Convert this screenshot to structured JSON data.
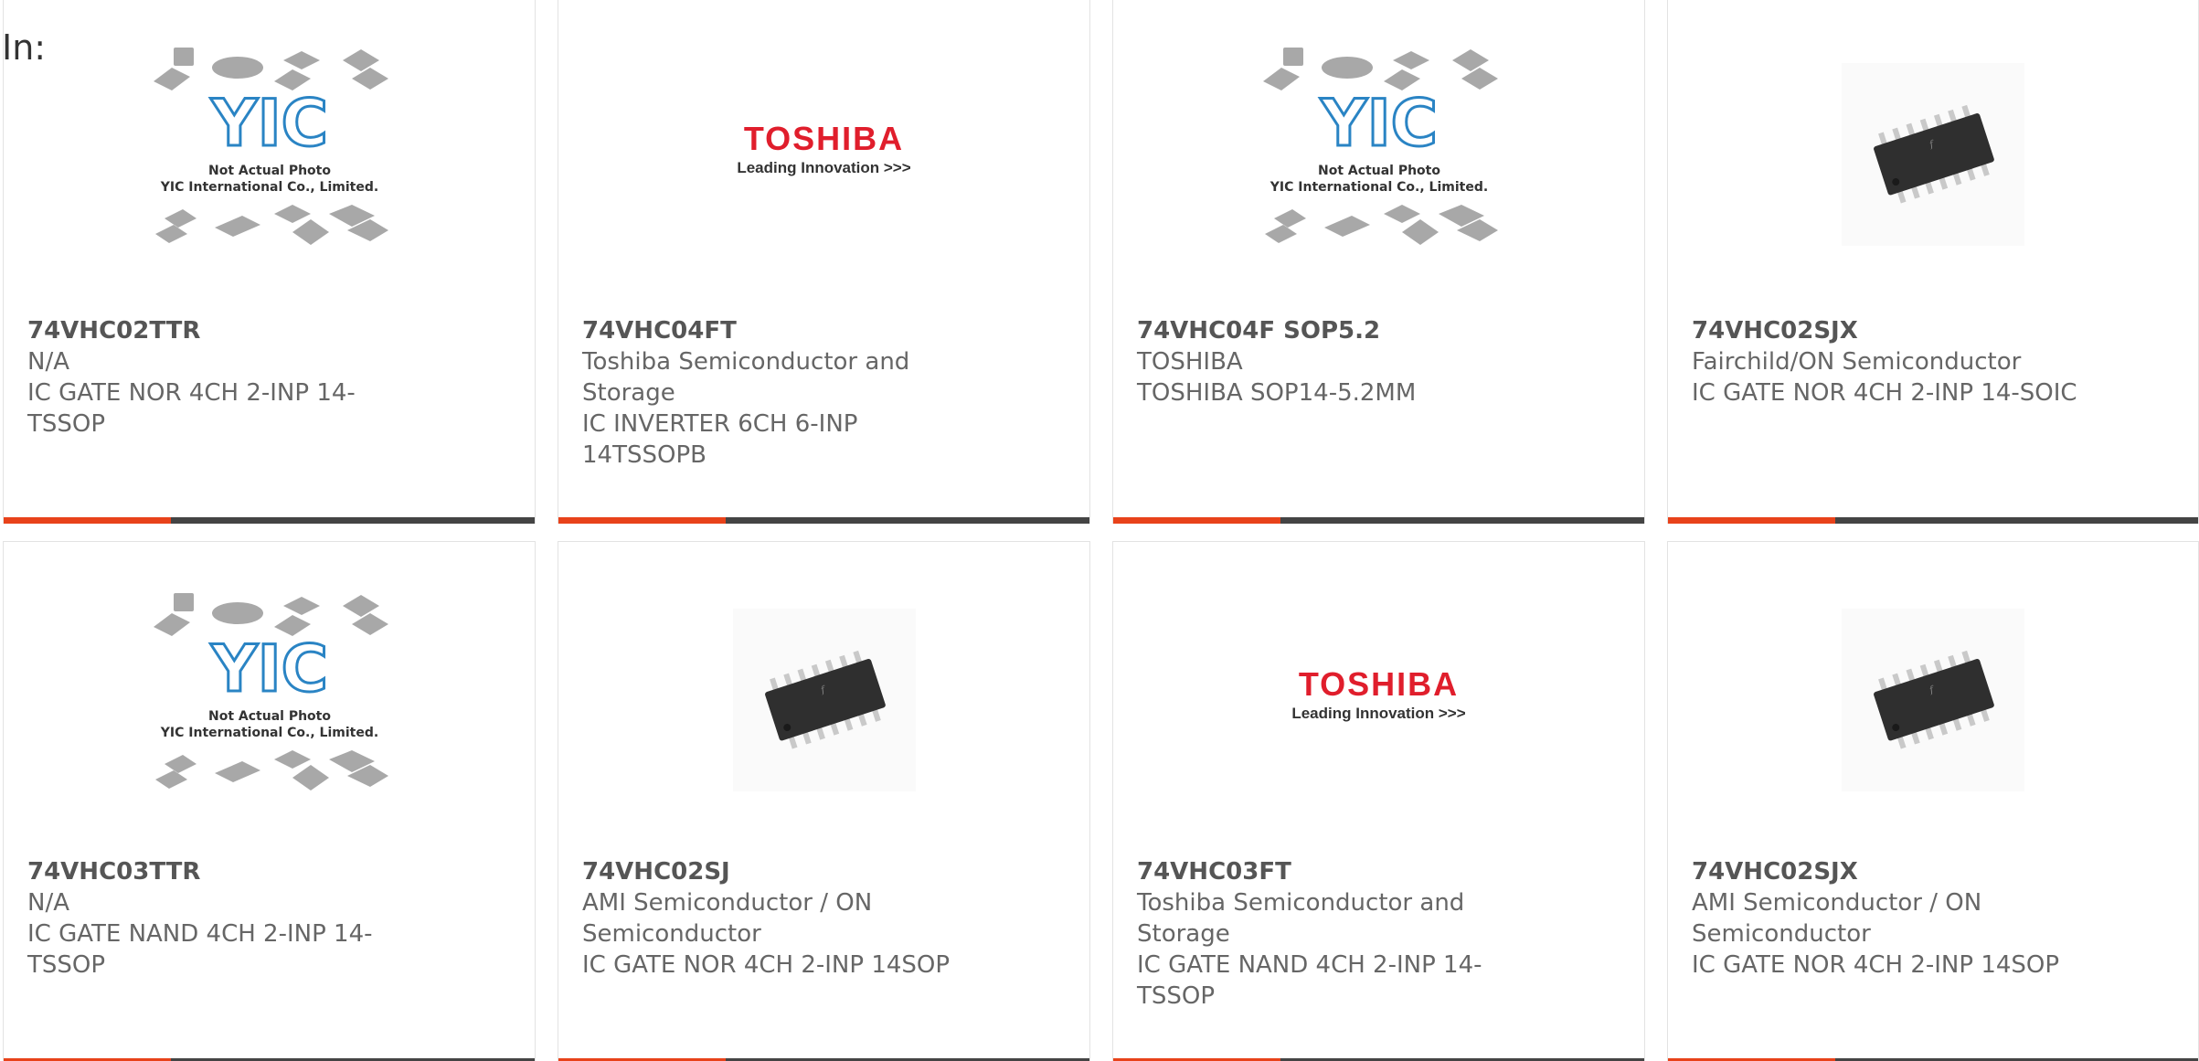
{
  "header": {
    "label": "In:"
  },
  "placeholder_image": {
    "line1": "Not Actual Photo",
    "line2": "YIC International Co., Limited.",
    "logo_text": "YIC"
  },
  "toshiba_logo": {
    "brand": "TOSHIBA",
    "tag": "Leading Innovation >>>"
  },
  "colors": {
    "accent": "#e8421a",
    "bar": "#444444",
    "toshiba_red": "#e01e2c",
    "yic_blue": "#2a84c4"
  },
  "products": [
    {
      "part": "74VHC02TTR",
      "maker": "N/A",
      "desc1": "IC GATE NOR 4CH 2-INP 14-",
      "desc2": "TSSOP",
      "image": "placeholder"
    },
    {
      "part": "74VHC04FT",
      "maker": "Toshiba Semiconductor and",
      "maker2": "Storage",
      "desc1": "IC INVERTER 6CH 6-INP",
      "desc2": "14TSSOPB",
      "image": "toshiba"
    },
    {
      "part": "74VHC04F SOP5.2",
      "maker": "TOSHIBA",
      "desc1": "TOSHIBA SOP14-5.2MM",
      "image": "placeholder"
    },
    {
      "part": "74VHC02SJX",
      "maker": "Fairchild/ON Semiconductor",
      "desc1": "IC GATE NOR 4CH 2-INP 14-SOIC",
      "image": "chip"
    },
    {
      "part": "74VHC03TTR",
      "maker": "N/A",
      "desc1": "IC GATE NAND 4CH 2-INP 14-",
      "desc2": "TSSOP",
      "image": "placeholder"
    },
    {
      "part": "74VHC02SJ",
      "maker": "AMI Semiconductor / ON",
      "maker2": "Semiconductor",
      "desc1": "IC GATE NOR 4CH 2-INP 14SOP",
      "image": "chip"
    },
    {
      "part": "74VHC03FT",
      "maker": "Toshiba Semiconductor and",
      "maker2": "Storage",
      "desc1": "IC GATE NAND 4CH 2-INP 14-",
      "desc2": "TSSOP",
      "image": "toshiba"
    },
    {
      "part": "74VHC02SJX",
      "maker": "AMI Semiconductor / ON",
      "maker2": "Semiconductor",
      "desc1": "IC GATE NOR 4CH 2-INP 14SOP",
      "image": "chip"
    }
  ]
}
